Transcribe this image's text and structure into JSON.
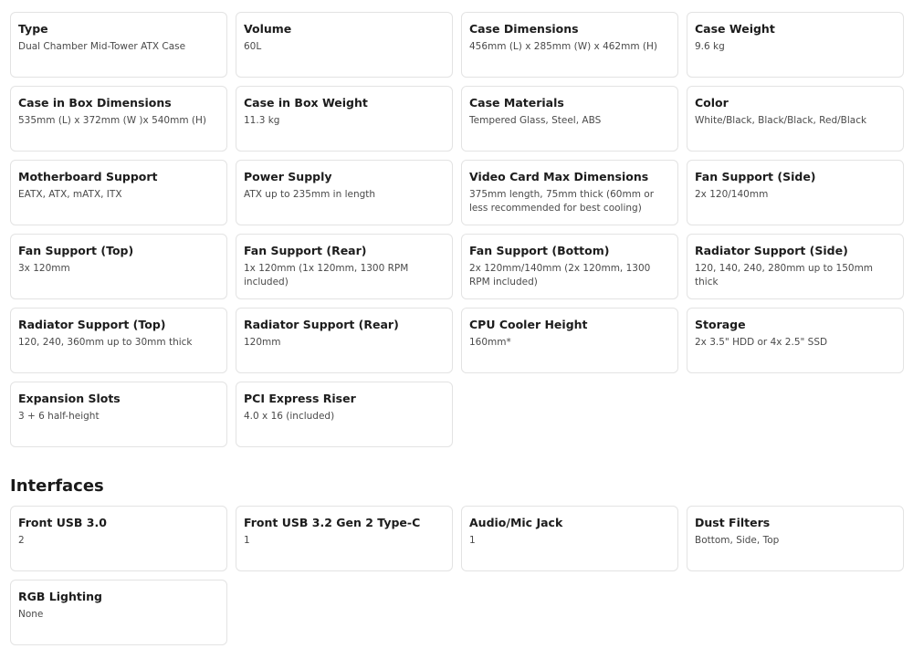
{
  "specs": [
    {
      "title": "Type",
      "value": "Dual Chamber Mid-Tower ATX Case"
    },
    {
      "title": "Volume",
      "value": "60L"
    },
    {
      "title": "Case Dimensions",
      "value": "456mm (L) x 285mm (W) x 462mm (H)"
    },
    {
      "title": "Case Weight",
      "value": "9.6 kg"
    },
    {
      "title": "Case in Box Dimensions",
      "value": "535mm (L) x 372mm (W )x 540mm (H)"
    },
    {
      "title": "Case in Box Weight",
      "value": "11.3 kg"
    },
    {
      "title": "Case Materials",
      "value": "Tempered Glass, Steel, ABS"
    },
    {
      "title": "Color",
      "value": "White/Black, Black/Black, Red/Black"
    },
    {
      "title": "Motherboard Support",
      "value": "EATX, ATX, mATX, ITX"
    },
    {
      "title": "Power Supply",
      "value": "ATX up to 235mm in length"
    },
    {
      "title": "Video Card Max Dimensions",
      "value": "375mm length, 75mm thick (60mm or less recommended for best cooling)"
    },
    {
      "title": "Fan Support (Side)",
      "value": "2x 120/140mm"
    },
    {
      "title": "Fan Support (Top)",
      "value": "3x 120mm"
    },
    {
      "title": "Fan Support (Rear)",
      "value": "1x 120mm (1x 120mm, 1300 RPM included)"
    },
    {
      "title": "Fan Support (Bottom)",
      "value": "2x 120mm/140mm (2x 120mm, 1300 RPM included)"
    },
    {
      "title": "Radiator Support (Side)",
      "value": "120, 140, 240, 280mm up to 150mm thick"
    },
    {
      "title": "Radiator Support (Top)",
      "value": "120, 240, 360mm up to 30mm thick"
    },
    {
      "title": "Radiator Support (Rear)",
      "value": "120mm"
    },
    {
      "title": "CPU Cooler Height",
      "value": "160mm*"
    },
    {
      "title": "Storage",
      "value": "2x 3.5\" HDD or 4x 2.5\" SSD"
    },
    {
      "title": "Expansion Slots",
      "value": "3 + 6 half-height"
    },
    {
      "title": "PCI Express Riser",
      "value": "4.0 x 16 (included)"
    }
  ],
  "interfaces_heading": "Interfaces",
  "interfaces": [
    {
      "title": "Front USB 3.0",
      "value": "2"
    },
    {
      "title": "Front USB 3.2 Gen 2 Type-C",
      "value": "1"
    },
    {
      "title": "Audio/Mic Jack",
      "value": "1"
    },
    {
      "title": "Dust Filters",
      "value": "Bottom, Side, Top"
    },
    {
      "title": "RGB Lighting",
      "value": "None"
    }
  ]
}
